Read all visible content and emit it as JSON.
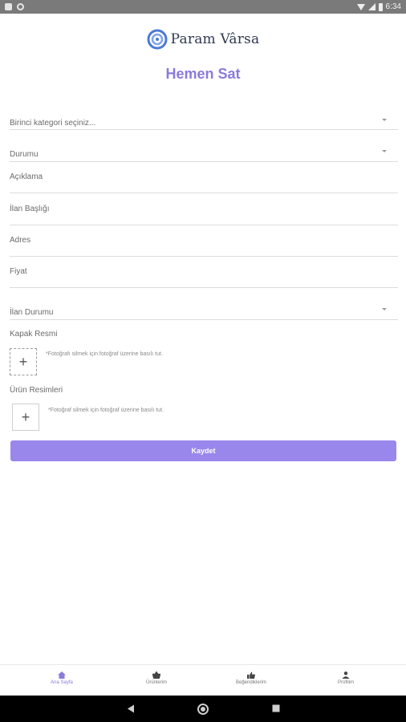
{
  "status_bar": {
    "time": "6:34"
  },
  "brand": {
    "name": "Param Vârsa",
    "accent_color": "#4b7ad6"
  },
  "page": {
    "title": "Hemen Sat",
    "accent": "#8a7bdc"
  },
  "form": {
    "category_placeholder": "Birinci kategori seçiniz...",
    "condition_label": "Durumu",
    "description_label": "Açıklama",
    "listing_title_label": "İlan Başlığı",
    "address_label": "Adres",
    "price_label": "Fiyat",
    "listing_status_label": "İlan Durumu",
    "cover_image_label": "Kapak Resmi",
    "cover_image_hint": "*Fotoğrafı silmek için fotoğraf üzerine basılı tut.",
    "product_images_label": "Ürün Resimleri",
    "product_images_hint": "*Fotoğraf silmek için fotoğraf üzerine basılı tut.",
    "add_symbol": "+",
    "save_label": "Kaydet"
  },
  "bottom_nav": {
    "items": [
      {
        "label": "Ana Sayfa",
        "icon": "home-icon",
        "active": true
      },
      {
        "label": "Ürünlerim",
        "icon": "basket-icon",
        "active": false
      },
      {
        "label": "Beğendiklerim",
        "icon": "thumbs-up-icon",
        "active": false
      },
      {
        "label": "Profilim",
        "icon": "user-icon",
        "active": false
      }
    ]
  }
}
